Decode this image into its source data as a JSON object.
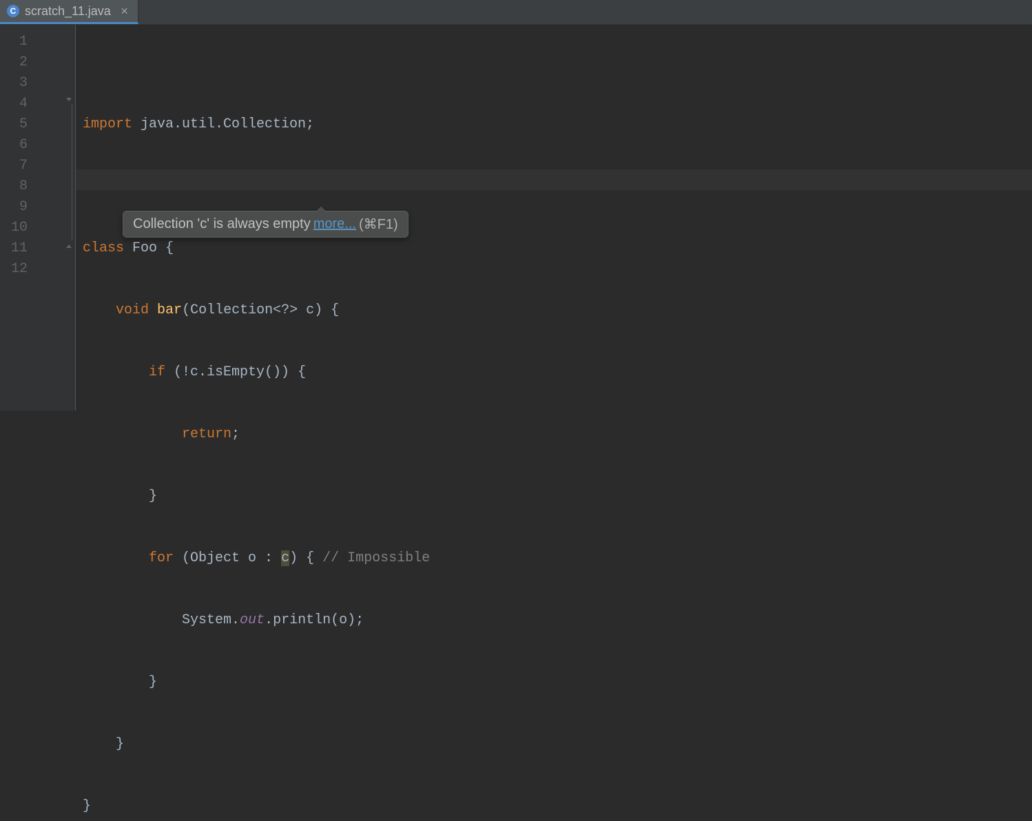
{
  "tab": {
    "icon_letter": "C",
    "filename": "scratch_11.java"
  },
  "gutter": {
    "lines": [
      "1",
      "2",
      "3",
      "4",
      "5",
      "6",
      "7",
      "8",
      "9",
      "10",
      "11",
      "12"
    ]
  },
  "code": {
    "l1": {
      "kw": "import",
      "rest": " java.util.Collection;"
    },
    "l3": {
      "kw": "class",
      "name": " Foo {"
    },
    "l4": {
      "indent": "    ",
      "kw": "void",
      "sp": " ",
      "method": "bar",
      "sig": "(Collection<?> c) {"
    },
    "l5": {
      "indent": "        ",
      "kw": "if",
      "rest": " (!c.isEmpty()) {"
    },
    "l6": {
      "indent": "            ",
      "kw": "return",
      "rest": ";"
    },
    "l7": {
      "indent": "        ",
      "rest": "}"
    },
    "l8": {
      "indent": "        ",
      "kw": "for",
      "rest1": " (Object o : ",
      "warn": "c",
      "rest2": ") { ",
      "comment": "// Impossible"
    },
    "l9": {
      "indent": "            ",
      "sys": "System.",
      "out": "out",
      "rest": ".println(o);"
    },
    "l10": {
      "indent": "        ",
      "rest": "}"
    },
    "l11": {
      "indent": "    ",
      "rest": "}"
    },
    "l12": {
      "rest": "}"
    }
  },
  "tooltip": {
    "message": "Collection 'c' is always empty ",
    "more": "more...",
    "shortcut": " (⌘F1)"
  }
}
